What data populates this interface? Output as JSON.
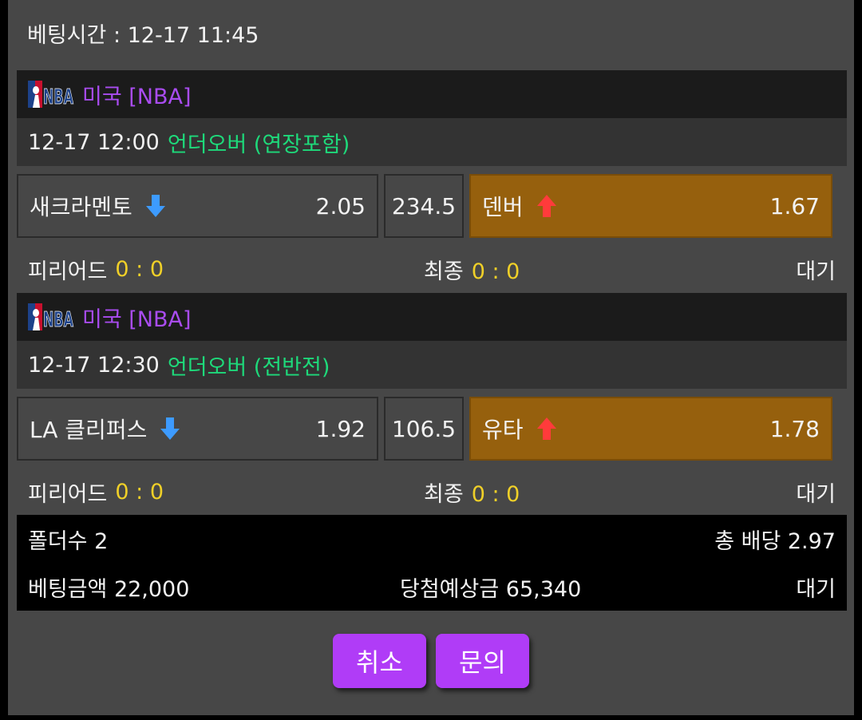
{
  "header": {
    "bet_time": "베팅시간 : 12-17 11:45"
  },
  "games": [
    {
      "league": "미국 [NBA]",
      "datetime": "12-17 12:00",
      "market": "언더오버 (연장포함)",
      "home_team": "새크라멘토",
      "home_odds": "2.05",
      "line": "234.5",
      "away_team": "덴버",
      "away_odds": "1.67",
      "period_label": "피리어드",
      "period_score": "0 : 0",
      "final_label": "최종",
      "final_score": "0 : 0",
      "status": "대기"
    },
    {
      "league": "미국 [NBA]",
      "datetime": "12-17 12:30",
      "market": "언더오버 (전반전)",
      "home_team": "LA 클리퍼스",
      "home_odds": "1.92",
      "line": "106.5",
      "away_team": "유타",
      "away_odds": "1.78",
      "period_label": "피리어드",
      "period_score": "0 : 0",
      "final_label": "최종",
      "final_score": "0 : 0",
      "status": "대기"
    }
  ],
  "summary": {
    "folder_count": "폴더수 2",
    "total_odds": "총 배당 2.97",
    "bet_amount": "베팅금액 22,000",
    "expected_win": "당첨예상금 65,340",
    "status": "대기"
  },
  "buttons": {
    "cancel": "취소",
    "inquiry": "문의"
  },
  "colors": {
    "league": "#a94cf0",
    "market": "#1ed97a",
    "score": "#f0d028",
    "selected": "#96600d",
    "down_arrow": "#3d9bff",
    "up_arrow": "#ff3b3b",
    "button": "#b03cf7"
  },
  "icons": {
    "league_logo": "nba-logo",
    "home_arrow": "arrow-down-icon",
    "away_arrow": "arrow-up-icon"
  }
}
